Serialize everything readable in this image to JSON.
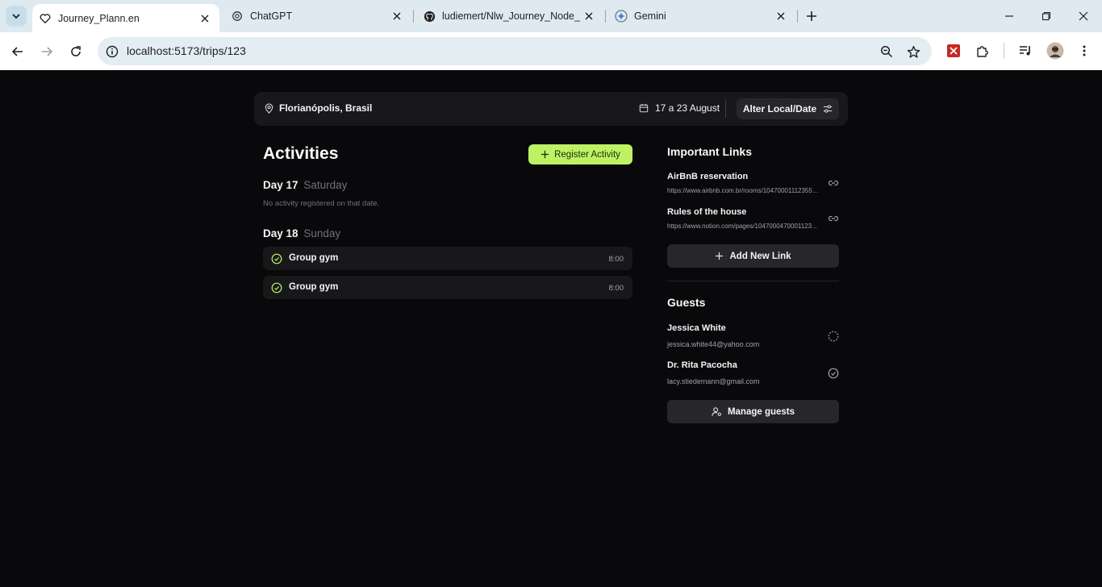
{
  "browser": {
    "tabs": [
      {
        "title": "Journey_Plann.en",
        "active": true
      },
      {
        "title": "ChatGPT",
        "active": false
      },
      {
        "title": "ludiemert/Nlw_Journey_Node_",
        "active": false
      },
      {
        "title": "Gemini",
        "active": false
      }
    ],
    "url": "localhost:5173/trips/123"
  },
  "trip": {
    "destination": "Florianópolis, Brasil",
    "dates": "17 a 23 August",
    "alter_label": "Alter Local/Date"
  },
  "activities": {
    "title": "Activities",
    "register_label": "Register Activity",
    "days": [
      {
        "day": "Day 17",
        "weekday": "Saturday",
        "empty_note": "No activity registered on that date."
      },
      {
        "day": "Day 18",
        "weekday": "Sunday",
        "items": [
          {
            "name": "Group gym",
            "time": "8:00"
          },
          {
            "name": "Group gym",
            "time": "8:00"
          }
        ]
      }
    ]
  },
  "links": {
    "title": "Important Links",
    "items": [
      {
        "title": "AirBnB reservation",
        "url": "https://www.airbnb.com.br/rooms/104700011123559..."
      },
      {
        "title": "Rules of the house",
        "url": "https://www.notion.com/pages/1047000470001123..."
      }
    ],
    "add_label": "Add New Link"
  },
  "guests": {
    "title": "Guests",
    "items": [
      {
        "name": "Jessica White",
        "email": "jessica.white44@yahoo.com",
        "confirmed": false
      },
      {
        "name": "Dr. Rita Pacocha",
        "email": "lacy.stiedemann@gmail.com",
        "confirmed": true
      }
    ],
    "manage_label": "Manage guests"
  },
  "colors": {
    "accent": "#bef264",
    "background": "#09090b",
    "card": "#18181b"
  }
}
